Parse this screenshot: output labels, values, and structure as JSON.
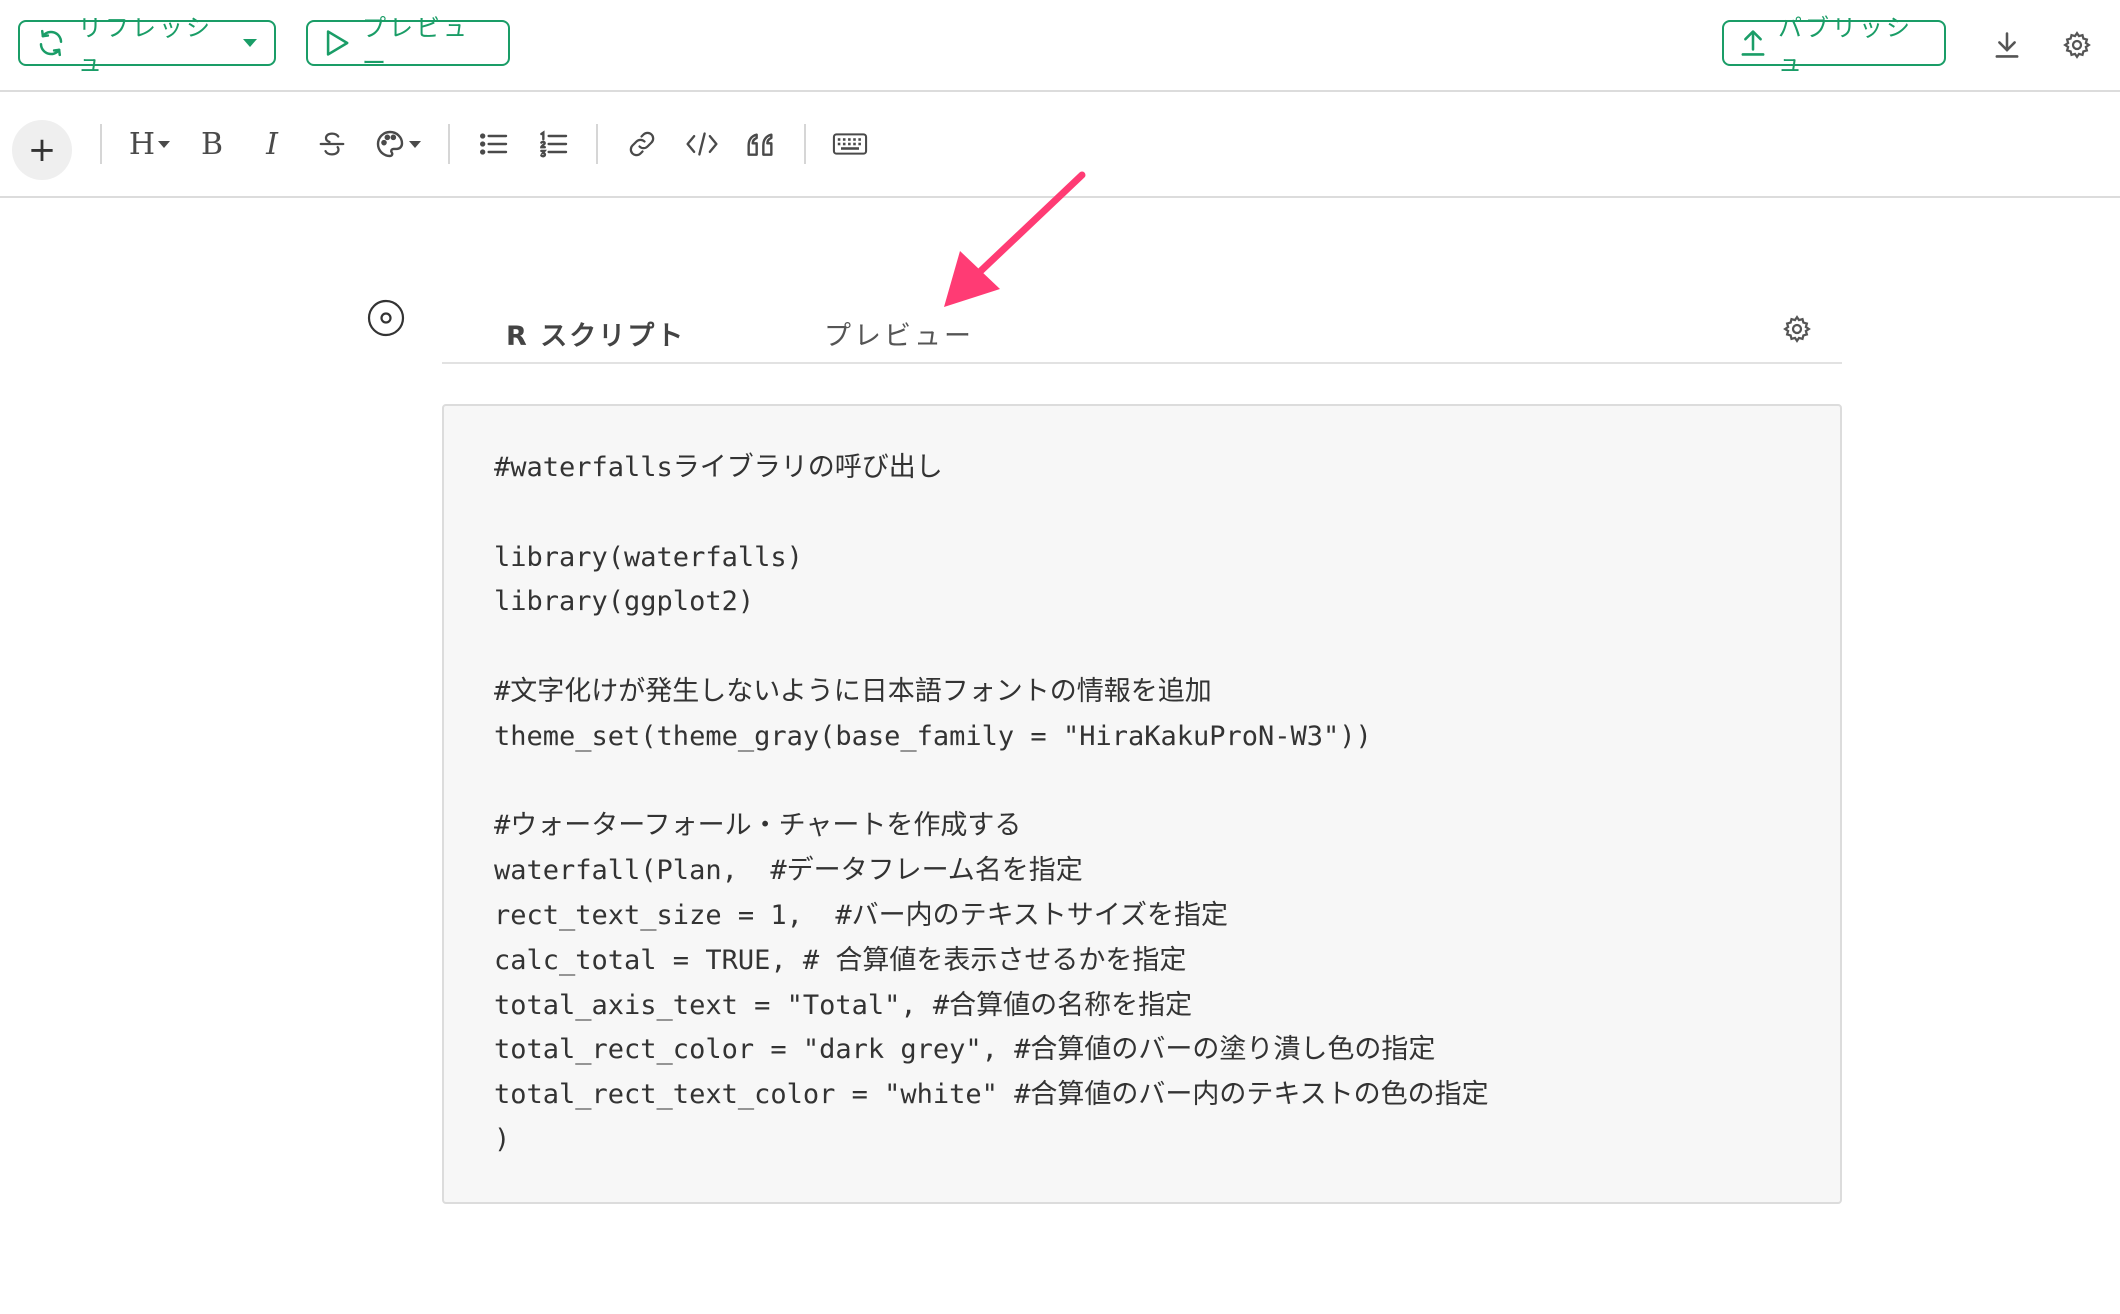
{
  "topbar": {
    "refresh_label": "リフレッシュ",
    "preview_label": "プレビュー",
    "publish_label": "パブリッシュ",
    "download_icon": "download-icon",
    "settings_icon": "gear-icon"
  },
  "toolbar": {
    "items": [
      "plus-icon",
      "heading-icon",
      "bold-icon",
      "italic-icon",
      "strikethrough-icon",
      "palette-icon",
      "bullet-list-icon",
      "numbered-list-icon",
      "link-icon",
      "code-icon",
      "quote-icon",
      "keyboard-icon"
    ],
    "heading_glyph": "H",
    "bold_glyph": "B",
    "italic_glyph": "I"
  },
  "block": {
    "tabs": [
      {
        "label": "R スクリプト",
        "active": true
      },
      {
        "label": "プレビュー",
        "active": false
      }
    ],
    "code_lines": [
      "#waterfallsライブラリの呼び出し",
      "",
      "library(waterfalls)",
      "library(ggplot2)",
      "",
      "#文字化けが発生しないように日本語フォントの情報を追加",
      "theme_set(theme_gray(base_family = \"HiraKakuProN-W3\"))",
      "",
      "#ウォーターフォール・チャートを作成する",
      "waterfall(Plan,  #データフレーム名を指定",
      "rect_text_size = 1,  #バー内のテキストサイズを指定",
      "calc_total = TRUE, # 合算値を表示させるかを指定",
      "total_axis_text = \"Total\", #合算値の名称を指定",
      "total_rect_color = \"dark grey\", #合算値のバーの塗り潰し色の指定",
      "total_rect_text_color = \"white\" #合算値のバー内のテキストの色の指定",
      ")"
    ]
  },
  "colors": {
    "accent_green": "#1a9d67",
    "annotation_arrow": "#ff3b74",
    "code_bg": "#f7f7f7"
  }
}
